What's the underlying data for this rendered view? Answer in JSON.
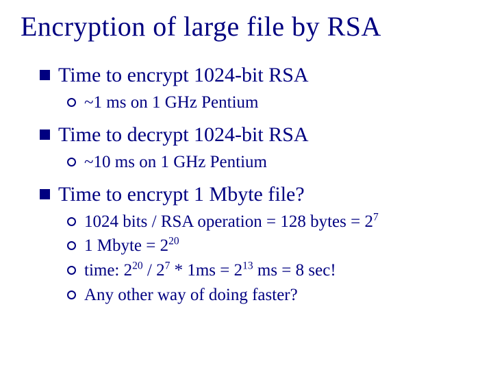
{
  "title": "Encryption of large file by RSA",
  "items": [
    {
      "text": "Time to encrypt 1024-bit RSA",
      "subs": [
        {
          "text": "~1 ms on 1 GHz Pentium"
        }
      ]
    },
    {
      "text": "Time to decrypt 1024-bit RSA",
      "subs": [
        {
          "text": "~10 ms on 1 GHz Pentium"
        }
      ]
    },
    {
      "text": "Time to encrypt 1 Mbyte file?",
      "subs": [
        {
          "html": "1024 bits / RSA operation = 128 bytes = 2<sup>7</sup>"
        },
        {
          "html": "1 Mbyte = 2<sup>20</sup>"
        },
        {
          "html": "time: 2<sup>20</sup> / 2<sup>7</sup> * 1ms = 2<sup>13</sup> ms = 8 sec!"
        },
        {
          "text": "Any other way of doing faster?"
        }
      ]
    }
  ]
}
